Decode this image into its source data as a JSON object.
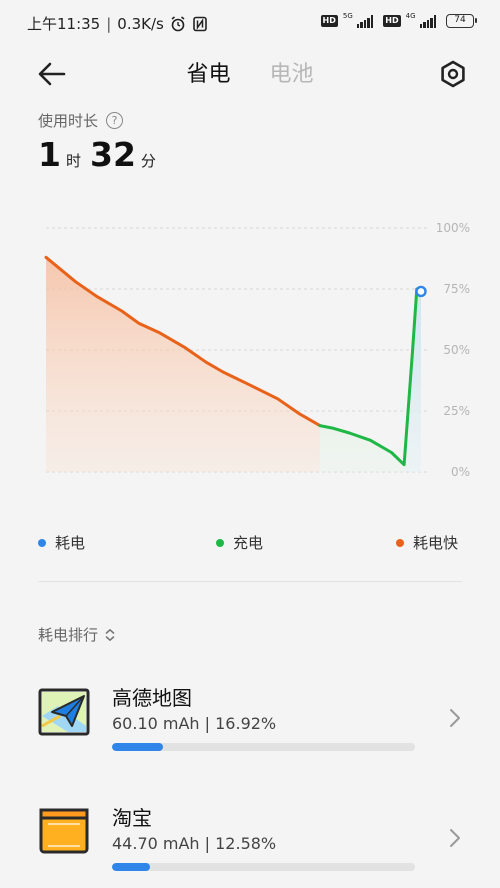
{
  "status_bar": {
    "time": "上午11:35",
    "speed": "0.3K/s",
    "signal1_label": "5G",
    "signal2_label": "4G",
    "hd_label": "HD",
    "battery_level": "74"
  },
  "header": {
    "tabs": [
      {
        "label": "省电",
        "active": true
      },
      {
        "label": "电池",
        "active": false
      }
    ]
  },
  "usage": {
    "label": "使用时长",
    "help": "?",
    "hours": "1",
    "hours_unit": "时",
    "minutes": "32",
    "minutes_unit": "分"
  },
  "chart_data": {
    "type": "line",
    "y_ticks": [
      "100%",
      "75%",
      "50%",
      "25%",
      "0%"
    ],
    "ylim": [
      0,
      100
    ],
    "series": [
      {
        "name": "耗电快",
        "color": "#e8621a",
        "x": [
          0,
          7,
          12,
          18,
          22,
          27,
          33,
          38,
          42,
          48,
          55,
          60,
          65
        ],
        "y": [
          88,
          78,
          72,
          66,
          61,
          57,
          51,
          45,
          41,
          36,
          30,
          24,
          19
        ]
      },
      {
        "name": "耗电",
        "color": "#2f86e8",
        "x": [
          65
        ],
        "y": [
          19
        ]
      },
      {
        "name": "充电",
        "color": "#1fb745",
        "x": [
          65,
          68,
          72,
          77,
          82,
          85,
          87,
          88,
          89
        ],
        "y": [
          19,
          18,
          16,
          13,
          8,
          3,
          50,
          75,
          75
        ]
      }
    ],
    "current_point": {
      "x": 89,
      "y": 74
    }
  },
  "legend": [
    {
      "label": "耗电",
      "color": "#2f86e8"
    },
    {
      "label": "充电",
      "color": "#1fb745"
    },
    {
      "label": "耗电快",
      "color": "#e8621a"
    }
  ],
  "rank": {
    "label": "耗电排行",
    "icon": "chevron-updown-icon"
  },
  "apps": [
    {
      "name": "高德地图",
      "usage": "60.10 mAh | 16.92%",
      "percent": 16.92,
      "icon": "amap-icon"
    },
    {
      "name": "淘宝",
      "usage": "44.70 mAh | 12.58%",
      "percent": 12.58,
      "icon": "taobao-icon"
    }
  ]
}
